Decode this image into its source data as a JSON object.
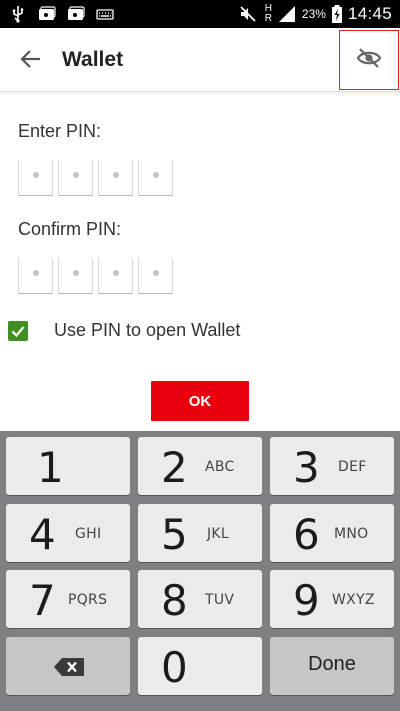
{
  "status_bar": {
    "left_icons": [
      "usb-icon",
      "photo-icon",
      "photo-icon",
      "keyboard-icon"
    ],
    "right_icons": [
      "mute-icon",
      "signal-icon",
      "battery-charging-icon"
    ],
    "network_h": "H",
    "network_r": "R",
    "battery_percent": "23%",
    "time": "14:45"
  },
  "app_bar": {
    "back_icon": "arrow-left-icon",
    "title": "Wallet",
    "visibility_icon": "eye-off-icon"
  },
  "form": {
    "enter_pin_label": "Enter PIN:",
    "confirm_pin_label": "Confirm PIN:",
    "pin_length": 4,
    "use_pin_checked": true,
    "use_pin_label": "Use PIN to open Wallet",
    "ok_label": "OK"
  },
  "keypad": {
    "keys": [
      {
        "num": "1",
        "letters": ""
      },
      {
        "num": "2",
        "letters": "ABC"
      },
      {
        "num": "3",
        "letters": "DEF"
      },
      {
        "num": "4",
        "letters": "GHI"
      },
      {
        "num": "5",
        "letters": "JKL"
      },
      {
        "num": "6",
        "letters": "MNO"
      },
      {
        "num": "7",
        "letters": "PQRS"
      },
      {
        "num": "8",
        "letters": "TUV"
      },
      {
        "num": "9",
        "letters": "WXYZ"
      },
      {
        "num": "0",
        "letters": ""
      }
    ],
    "backspace_icon": "backspace-icon",
    "done_label": "Done"
  },
  "colors": {
    "accent_red": "#e8000d",
    "checkbox_green": "#3f8f24",
    "keypad_bg": "#7f8083",
    "status_bar_bg": "#000000"
  }
}
